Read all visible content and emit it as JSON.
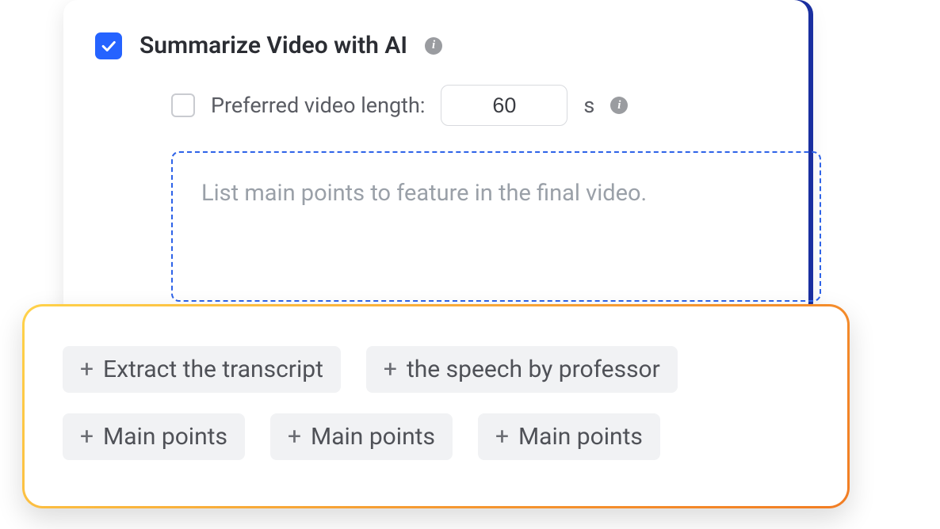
{
  "summarize": {
    "checked": true,
    "title": "Summarize Video with AI"
  },
  "length": {
    "checked": false,
    "label": "Preferred video length:",
    "value": "60",
    "unit": "s"
  },
  "prompt": {
    "placeholder": "List main points to feature in the final video."
  },
  "suggestions": [
    "Extract the transcript",
    "the speech by professor",
    "Main points",
    "Main points",
    "Main points"
  ]
}
